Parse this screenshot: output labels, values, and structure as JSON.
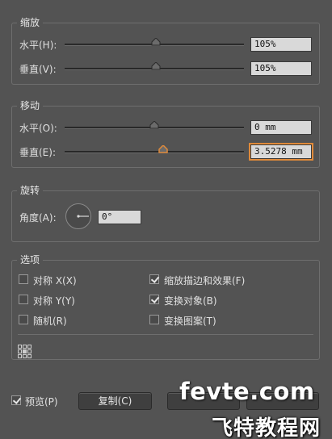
{
  "scale": {
    "legend": "缩放",
    "horizontal": {
      "label": "水平(H):",
      "value": "105%",
      "level": 0.51
    },
    "vertical": {
      "label": "垂直(V):",
      "value": "105%",
      "level": 0.51
    }
  },
  "move": {
    "legend": "移动",
    "horizontal": {
      "label": "水平(O):",
      "value": "0 mm",
      "level": 0.5
    },
    "vertical": {
      "label": "垂直(E):",
      "value": "3.5278 mm",
      "level": 0.55
    }
  },
  "rotate": {
    "legend": "旋转",
    "angle_label": "角度(A):",
    "angle_value": "0°"
  },
  "options": {
    "legend": "选项",
    "items": [
      {
        "label": "对称 X(X)",
        "checked": false
      },
      {
        "label": "对称 Y(Y)",
        "checked": false
      },
      {
        "label": "随机(R)",
        "checked": false
      },
      {
        "label": "缩放描边和效果(F)",
        "checked": true
      },
      {
        "label": "变换对象(B)",
        "checked": true
      },
      {
        "label": "变换图案(T)",
        "checked": false
      }
    ]
  },
  "footer": {
    "preview_label": "预览(P)",
    "preview_checked": true,
    "copy_label": "复制(C)"
  },
  "watermark": {
    "brand": "fevte.com",
    "site_cn": "飞特教程网"
  },
  "colors": {
    "background": "#535353",
    "focus": "#e08a3a",
    "field": "#d9d9d9"
  }
}
